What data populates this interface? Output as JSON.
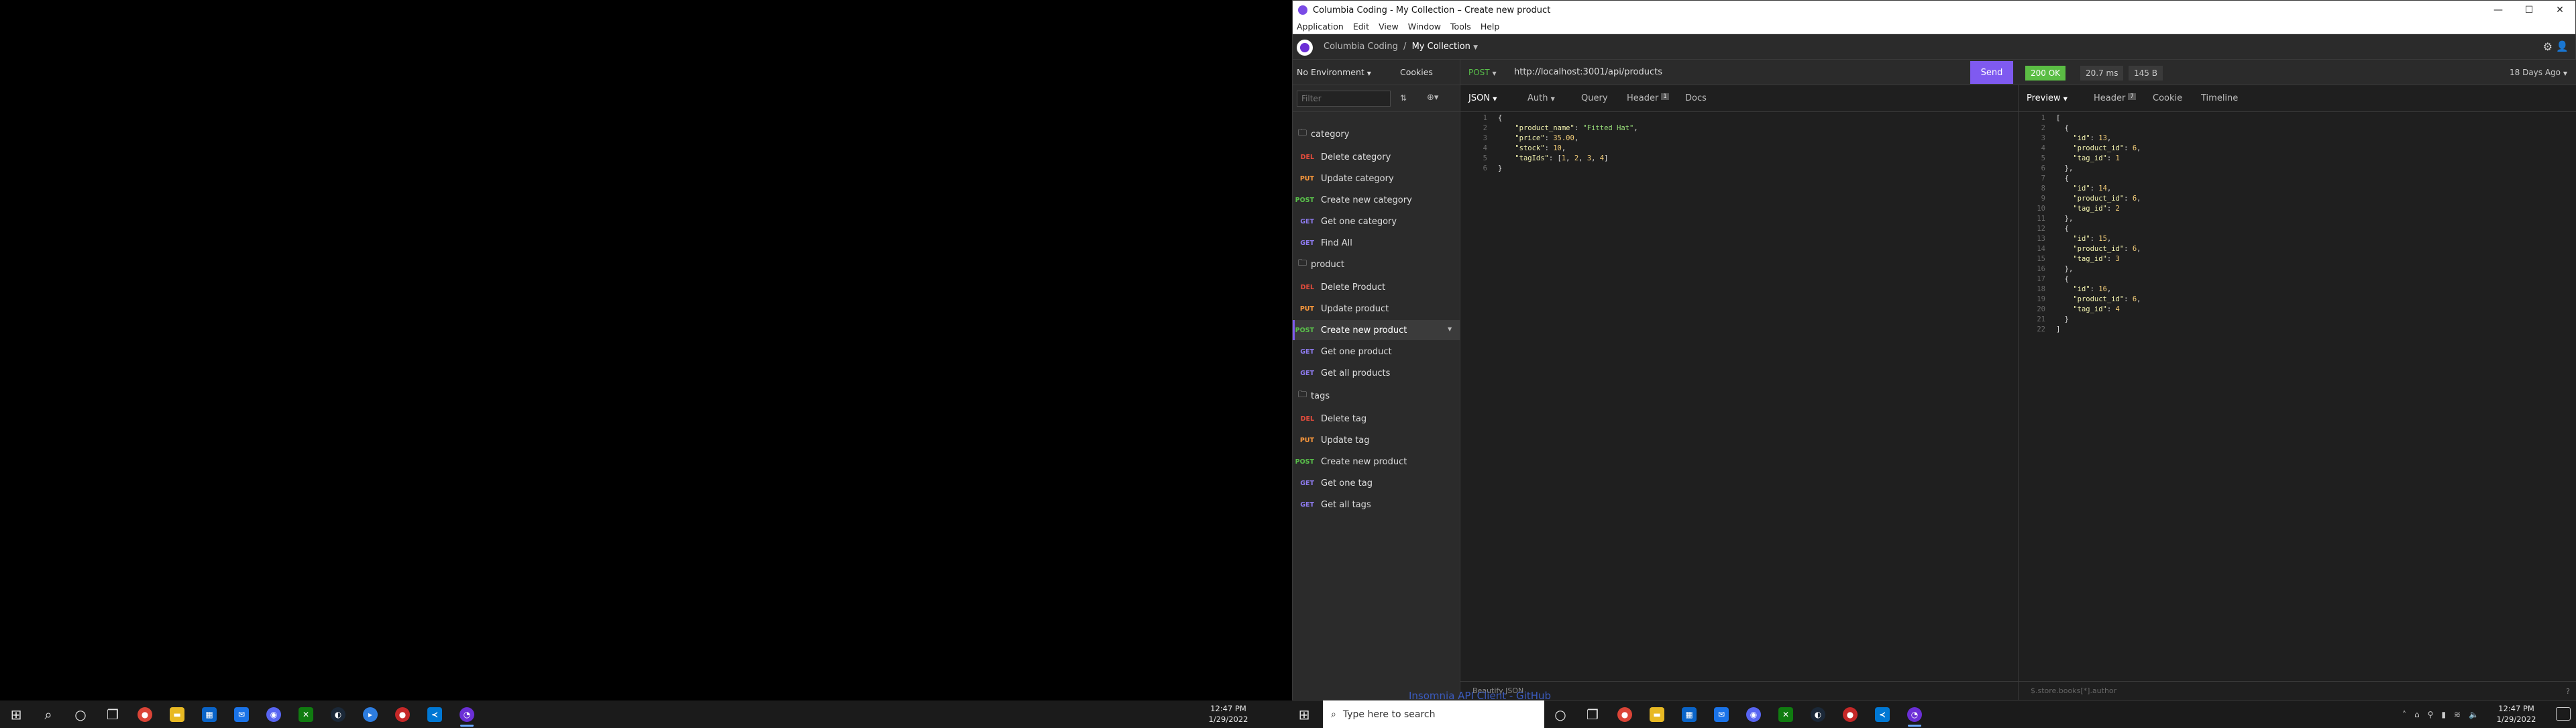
{
  "window": {
    "title": "Columbia Coding - My Collection – Create new product",
    "minimize": "—",
    "maximize": "☐",
    "close": "✕"
  },
  "menu": [
    "Application",
    "Edit",
    "View",
    "Window",
    "Tools",
    "Help"
  ],
  "header": {
    "org": "Columbia Coding",
    "separator": "/",
    "collection": "My Collection"
  },
  "sidebar": {
    "environment": "No Environment",
    "cookies": "Cookies",
    "filter_placeholder": "Filter",
    "folders": [
      {
        "name": "category",
        "requests": [
          {
            "method": "DEL",
            "label": "Delete category"
          },
          {
            "method": "PUT",
            "label": "Update category"
          },
          {
            "method": "POST",
            "label": "Create new category"
          },
          {
            "method": "GET",
            "label": "Get one category"
          },
          {
            "method": "GET",
            "label": "Find All"
          }
        ]
      },
      {
        "name": "product",
        "requests": [
          {
            "method": "DEL",
            "label": "Delete Product"
          },
          {
            "method": "PUT",
            "label": "Update product"
          },
          {
            "method": "POST",
            "label": "Create new product"
          },
          {
            "method": "GET",
            "label": "Get one product"
          },
          {
            "method": "GET",
            "label": "Get all products"
          }
        ]
      },
      {
        "name": "tags",
        "requests": [
          {
            "method": "DEL",
            "label": "Delete tag"
          },
          {
            "method": "PUT",
            "label": "Update tag"
          },
          {
            "method": "POST",
            "label": "Create new product"
          },
          {
            "method": "GET",
            "label": "Get one tag"
          },
          {
            "method": "GET",
            "label": "Get all tags"
          }
        ]
      }
    ]
  },
  "request": {
    "method": "POST",
    "url": "http://localhost:3001/api/products",
    "send": "Send",
    "body_type": "JSON",
    "tabs": {
      "auth": "Auth",
      "query": "Query",
      "header": "Header",
      "header_count": "1",
      "docs": "Docs"
    },
    "body_lines": [
      "{",
      "    \"product_name\": \"Fitted Hat\",",
      "    \"price\": 35.00,",
      "    \"stock\": 10,",
      "    \"tagIds\": [1, 2, 3, 4]",
      "}"
    ],
    "footer": "Beautify JSON"
  },
  "response": {
    "status": "200 OK",
    "time": "20.7 ms",
    "size": "145 B",
    "age": "18 Days Ago",
    "tabs": {
      "preview": "Preview",
      "header": "Header",
      "header_count": "7",
      "cookie": "Cookie",
      "timeline": "Timeline"
    },
    "body_lines": [
      "[",
      "  {",
      "    \"id\": 13,",
      "    \"product_id\": 6,",
      "    \"tag_id\": 1",
      "  },",
      "  {",
      "    \"id\": 14,",
      "    \"product_id\": 6,",
      "    \"tag_id\": 2",
      "  },",
      "  {",
      "    \"id\": 15,",
      "    \"product_id\": 6,",
      "    \"tag_id\": 3",
      "  },",
      "  {",
      "    \"id\": 16,",
      "    \"product_id\": 6,",
      "    \"tag_id\": 4",
      "  }",
      "]"
    ],
    "footer": "$.store.books[*].author"
  },
  "taskbar_left": {
    "time": "12:47 PM",
    "date": "1/29/2022",
    "tooltip": "Insomnia API Client - GitHub"
  },
  "taskbar_right": {
    "search_placeholder": "Type here to search",
    "time": "12:47 PM",
    "date": "1/29/2022"
  },
  "colors": {
    "accent": "#7f5af0",
    "ok": "#5bbd44",
    "del": "#e74c3c",
    "put": "#ff9a3c",
    "post": "#59c04a",
    "get": "#8e7bf0"
  }
}
